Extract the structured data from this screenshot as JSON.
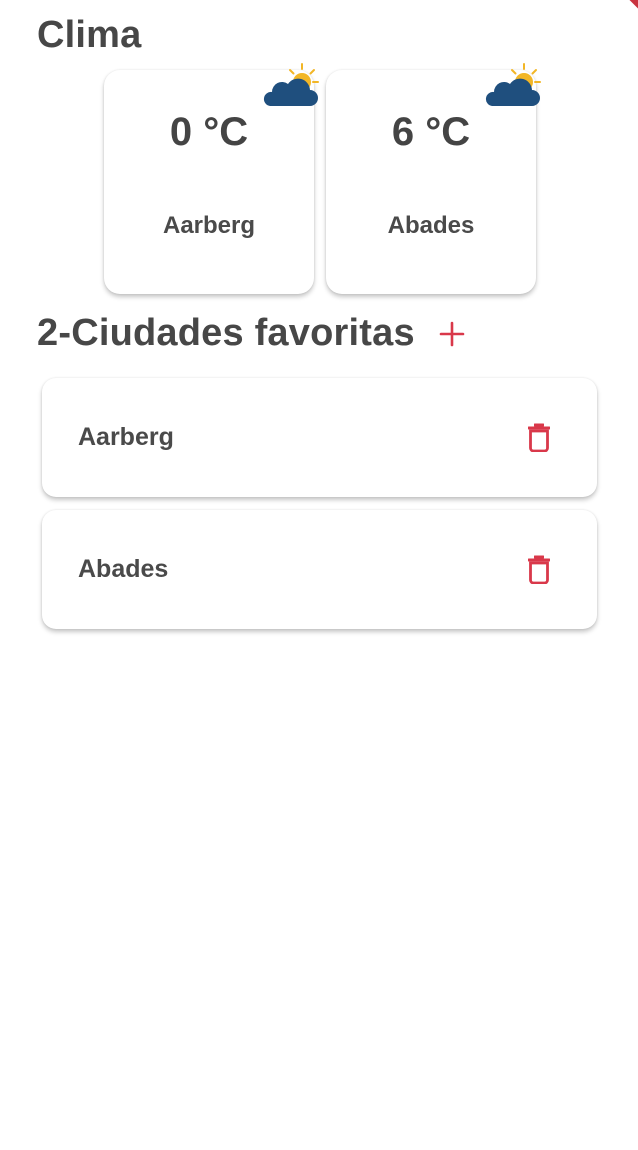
{
  "header": {
    "title": "Clima"
  },
  "weather_cards": [
    {
      "temp": "0 °C",
      "city": "Aarberg",
      "icon": "partly-cloudy-icon"
    },
    {
      "temp": "6 °C",
      "city": "Abades",
      "icon": "partly-cloudy-icon"
    }
  ],
  "favorites": {
    "title": "2-Ciudades favoritas",
    "add_icon": "plus-icon",
    "items": [
      {
        "name": "Aarberg",
        "delete_icon": "trash-icon"
      },
      {
        "name": "Abades",
        "delete_icon": "trash-icon"
      }
    ]
  },
  "colors": {
    "accent": "#d9384a",
    "text": "#454545",
    "cloud": "#1f4f7e",
    "sun": "#f2b626"
  }
}
